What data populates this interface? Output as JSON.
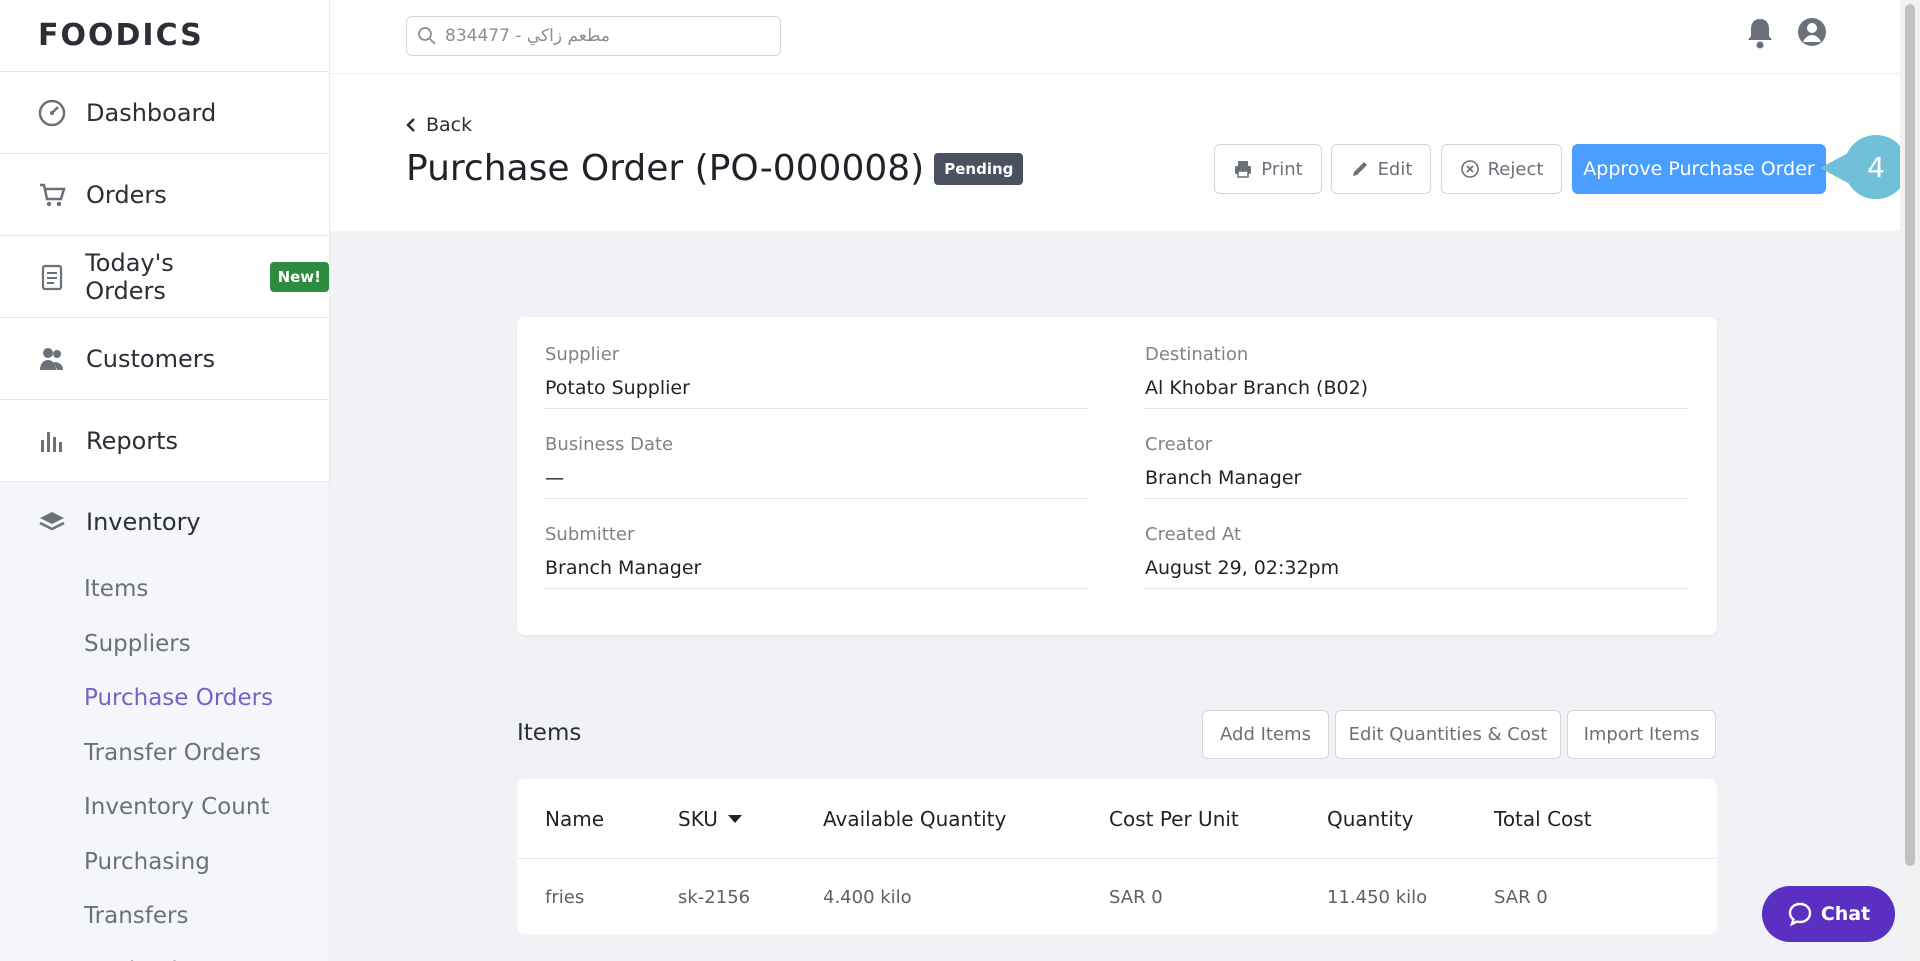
{
  "app": {
    "logo": "FOODICS"
  },
  "sidebar": {
    "items": [
      {
        "label": "Dashboard",
        "icon": "dashboard-icon"
      },
      {
        "label": "Orders",
        "icon": "cart-icon"
      },
      {
        "label": "Today's Orders",
        "icon": "clipboard-icon",
        "badge": "New!"
      },
      {
        "label": "Customers",
        "icon": "customers-icon"
      },
      {
        "label": "Reports",
        "icon": "bar-chart-icon"
      }
    ],
    "inventory": {
      "label": "Inventory",
      "icon": "layers-icon",
      "sub_items": [
        "Items",
        "Suppliers",
        "Purchase Orders",
        "Transfer Orders",
        "Inventory Count",
        "Purchasing",
        "Transfers",
        "Production"
      ],
      "active": "Purchase Orders"
    }
  },
  "topbar": {
    "search_placeholder": "مطعم زاكي - 834477"
  },
  "header": {
    "back_label": "Back",
    "title": "Purchase Order (PO-000008)",
    "status": "Pending",
    "print_label": "Print",
    "edit_label": "Edit",
    "reject_label": "Reject",
    "approve_label": "Approve Purchase Order",
    "step_number": "4"
  },
  "details": {
    "supplier_label": "Supplier",
    "supplier": "Potato Supplier",
    "destination_label": "Destination",
    "destination": "Al Khobar Branch (B02)",
    "business_date_label": "Business Date",
    "business_date": "—",
    "creator_label": "Creator",
    "creator": "Branch Manager",
    "submitter_label": "Submitter",
    "submitter": "Branch Manager",
    "created_at_label": "Created At",
    "created_at": "August 29, 02:32pm"
  },
  "items_section": {
    "title": "Items",
    "add_label": "Add Items",
    "edit_label": "Edit Quantities & Cost",
    "import_label": "Import Items",
    "columns": [
      "Name",
      "SKU",
      "Available Quantity",
      "Cost Per Unit",
      "Quantity",
      "Total Cost"
    ],
    "rows": [
      {
        "name": "fries",
        "sku": "sk-2156",
        "available": "4.400 kilo",
        "cost": "SAR 0",
        "quantity": "11.450 kilo",
        "total": "SAR 0"
      }
    ]
  },
  "chat": {
    "label": "Chat"
  },
  "colors": {
    "primary": "#4a9eff",
    "active_nav": "#7b5fc7",
    "chat": "#5a2fc2",
    "badge_new": "#2e8b3f",
    "badge_pending": "#4a5160"
  }
}
